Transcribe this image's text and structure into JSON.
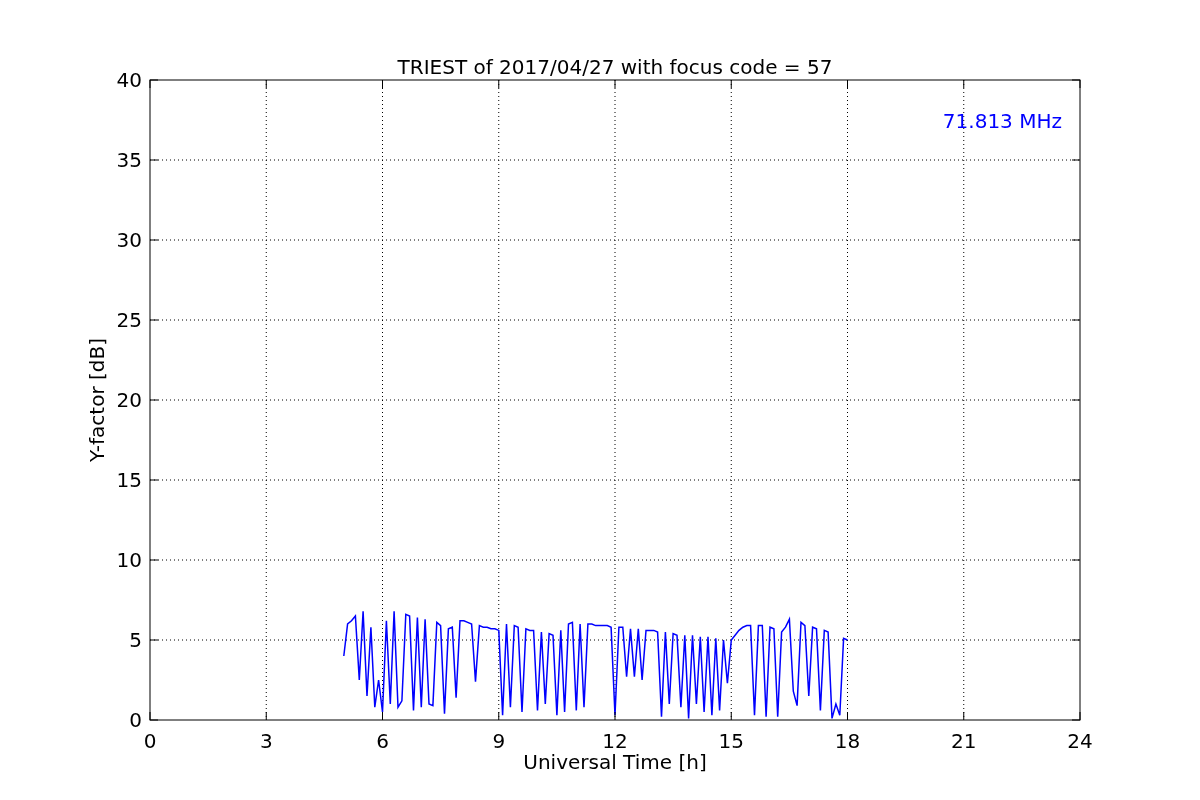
{
  "figure": {
    "chart_data": {
      "type": "line",
      "title": "TRIEST of 2017/04/27 with focus code = 57",
      "xlabel": "Universal Time [h]",
      "ylabel": "Y-factor [dB]",
      "xlim": [
        0,
        24
      ],
      "ylim": [
        0,
        40
      ],
      "xticks": [
        0,
        3,
        6,
        9,
        12,
        15,
        18,
        21,
        24
      ],
      "yticks": [
        0,
        5,
        10,
        15,
        20,
        25,
        30,
        35,
        40
      ],
      "x": [
        5.0,
        5.1,
        5.2,
        5.3,
        5.4,
        5.5,
        5.6,
        5.7,
        5.8,
        5.9,
        6.0,
        6.1,
        6.2,
        6.3,
        6.4,
        6.5,
        6.6,
        6.7,
        6.8,
        6.9,
        7.0,
        7.1,
        7.2,
        7.3,
        7.4,
        7.5,
        7.6,
        7.7,
        7.8,
        7.9,
        8.0,
        8.1,
        8.2,
        8.3,
        8.4,
        8.5,
        8.6,
        8.7,
        8.8,
        8.9,
        9.0,
        9.1,
        9.2,
        9.3,
        9.4,
        9.5,
        9.6,
        9.7,
        9.8,
        9.9,
        10.0,
        10.1,
        10.2,
        10.3,
        10.4,
        10.5,
        10.6,
        10.7,
        10.8,
        10.9,
        11.0,
        11.1,
        11.2,
        11.3,
        11.4,
        11.5,
        11.6,
        11.7,
        11.8,
        11.9,
        12.0,
        12.1,
        12.2,
        12.3,
        12.4,
        12.5,
        12.6,
        12.7,
        12.8,
        12.9,
        13.0,
        13.1,
        13.2,
        13.3,
        13.4,
        13.5,
        13.6,
        13.7,
        13.8,
        13.9,
        14.0,
        14.1,
        14.2,
        14.3,
        14.4,
        14.5,
        14.6,
        14.7,
        14.8,
        14.9,
        15.0,
        15.1,
        15.2,
        15.3,
        15.4,
        15.5,
        15.6,
        15.7,
        15.8,
        15.9,
        16.0,
        16.1,
        16.2,
        16.3,
        16.4,
        16.5,
        16.6,
        16.7,
        16.8,
        16.9,
        17.0,
        17.1,
        17.2,
        17.3,
        17.4,
        17.5,
        17.6,
        17.7,
        17.8,
        17.9,
        18.0
      ],
      "series": [
        {
          "name": "71.813 MHz",
          "color": "#0000ff",
          "values": [
            4.0,
            6.0,
            6.2,
            6.5,
            2.5,
            6.8,
            1.5,
            5.8,
            0.8,
            2.5,
            0.5,
            6.2,
            1.0,
            6.8,
            0.8,
            1.2,
            6.6,
            6.5,
            0.6,
            6.4,
            0.8,
            6.3,
            1.0,
            0.9,
            6.1,
            5.9,
            0.4,
            5.7,
            5.8,
            1.4,
            6.2,
            6.2,
            6.1,
            6.0,
            2.4,
            5.9,
            5.8,
            5.8,
            5.7,
            5.7,
            5.6,
            0.3,
            6.0,
            0.8,
            5.9,
            5.8,
            0.5,
            5.7,
            5.6,
            5.6,
            0.6,
            5.5,
            1.0,
            5.4,
            5.3,
            0.3,
            5.6,
            0.5,
            6.0,
            6.1,
            0.6,
            6.0,
            0.8,
            6.0,
            6.0,
            5.9,
            5.9,
            5.9,
            5.9,
            5.8,
            0.3,
            5.8,
            5.8,
            2.7,
            5.7,
            2.7,
            5.7,
            2.5,
            5.6,
            5.6,
            5.6,
            5.5,
            0.2,
            5.5,
            1.0,
            5.4,
            5.3,
            0.8,
            5.3,
            0.1,
            5.3,
            1.0,
            5.2,
            0.5,
            5.2,
            0.3,
            5.1,
            0.6,
            5.0,
            2.3,
            5.0,
            5.3,
            5.6,
            5.8,
            5.9,
            5.9,
            0.3,
            5.9,
            5.9,
            0.2,
            5.8,
            5.7,
            0.2,
            5.5,
            5.8,
            6.3,
            1.8,
            0.9,
            6.1,
            5.9,
            1.5,
            5.8,
            5.7,
            0.6,
            5.6,
            5.5,
            0.1,
            1.0,
            0.3,
            5.1,
            5.0
          ]
        }
      ],
      "grid": true
    }
  }
}
